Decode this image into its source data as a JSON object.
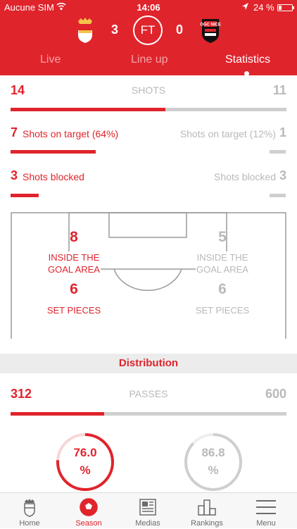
{
  "status_bar": {
    "carrier": "Aucune SIM",
    "time": "14:06",
    "battery": "24 %"
  },
  "match": {
    "home_score": "3",
    "status": "FT",
    "away_score": "0",
    "away_crest_text": "OGC NICE"
  },
  "tabs": [
    {
      "label": "Live",
      "active": false
    },
    {
      "label": "Line up",
      "active": false
    },
    {
      "label": "Statistics",
      "active": true
    }
  ],
  "shots": {
    "label": "SHOTS",
    "home": "14",
    "away": "11",
    "home_share": 0.56,
    "on_target": {
      "home_num": "7",
      "home_label": "Shots on target (64%)",
      "away_label": "Shots on target (12%)",
      "away_num": "1"
    },
    "blocked": {
      "home_num": "3",
      "home_label": "Shots blocked",
      "away_label": "Shots blocked",
      "away_num": "3"
    },
    "inside_area": {
      "home": "8",
      "away": "5",
      "label_line1": "INSIDE THE",
      "label_line2": "GOAL AREA"
    },
    "set_pieces": {
      "home": "6",
      "away": "6",
      "label": "SET PIECES"
    }
  },
  "distribution": {
    "title": "Distribution",
    "passes": {
      "label": "PASSES",
      "home": "312",
      "away": "600",
      "home_share": 0.34
    },
    "accuracy": {
      "home": {
        "value": "76.0",
        "unit": "%",
        "fraction": 0.76
      },
      "away": {
        "value": "86.8",
        "unit": "%",
        "fraction": 0.868
      }
    }
  },
  "nav": [
    {
      "label": "Home",
      "icon": "club-crest-icon"
    },
    {
      "label": "Season",
      "icon": "football-icon"
    },
    {
      "label": "Medias",
      "icon": "newspaper-icon"
    },
    {
      "label": "Rankings",
      "icon": "podium-icon"
    },
    {
      "label": "Menu",
      "icon": "hamburger-icon"
    }
  ],
  "colors": {
    "accent": "#e0242c",
    "muted": "#b9b9b9",
    "track": "#cfcfcf"
  }
}
